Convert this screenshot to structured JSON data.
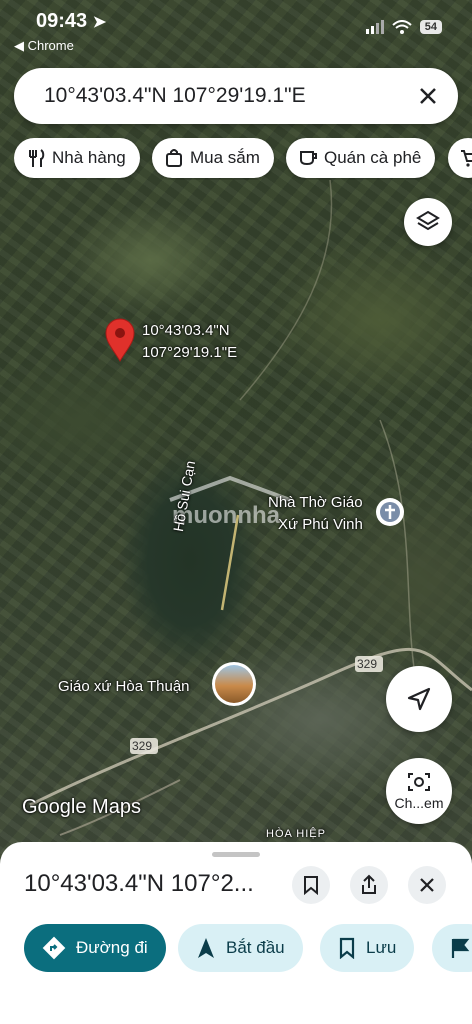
{
  "status_bar": {
    "time": "09:43",
    "back_app": "◀ Chrome",
    "battery": "54"
  },
  "search": {
    "value": "10°43'03.4\"N 107°29'19.1\"E"
  },
  "chips": [
    {
      "label": "Nhà hàng",
      "icon": "restaurant-icon"
    },
    {
      "label": "Mua sắm",
      "icon": "shopping-bag-icon"
    },
    {
      "label": "Quán cà phê",
      "icon": "coffee-icon"
    }
  ],
  "map": {
    "pin_label_line1": "10°43'03.4\"N",
    "pin_label_line2": "107°29'19.1\"E",
    "church_line1": "Nhà Thờ Giáo",
    "church_line2": "Xứ Phú Vinh",
    "lake": "Hồ Sui Cạn",
    "parish": "Giáo xứ Hòa Thuận",
    "road_329_a": "329",
    "road_329_b": "329",
    "hoa_hiep": "HÒA HIỆP",
    "watermark": "muonnha",
    "google_maps": "Google Maps",
    "camera_label": "Ch...em"
  },
  "sheet": {
    "title": "10°43'03.4\"N 107°2...",
    "actions": [
      {
        "label": "Đường đi",
        "icon": "directions-icon"
      },
      {
        "label": "Bắt đầu",
        "icon": "navigation-arrow-icon"
      },
      {
        "label": "Lưu",
        "icon": "bookmark-icon"
      }
    ]
  },
  "colors": {
    "accent": "#0b6e7e",
    "secondary_action_bg": "#d9f0f5",
    "pin": "#e0312b"
  }
}
